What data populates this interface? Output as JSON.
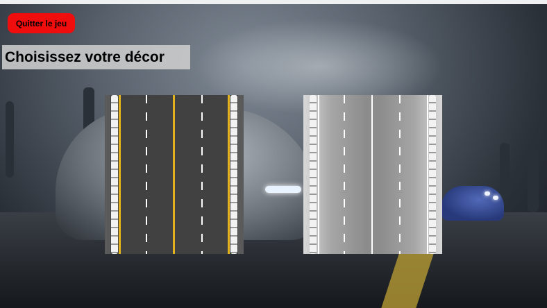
{
  "menu": {
    "quit_label": "Quitter le jeu",
    "title": "Choisissez votre décor"
  },
  "decors": [
    {
      "name": "asphalt-road",
      "style": "dark asphalt, yellow edge lines"
    },
    {
      "name": "grey-road",
      "style": "light grey gradient, white lines"
    }
  ],
  "colors": {
    "quit_button": "#ef0d0d",
    "title_background": "#cdcdcd",
    "road_dark": "#414141",
    "yellow_line": "#e3b21e"
  }
}
